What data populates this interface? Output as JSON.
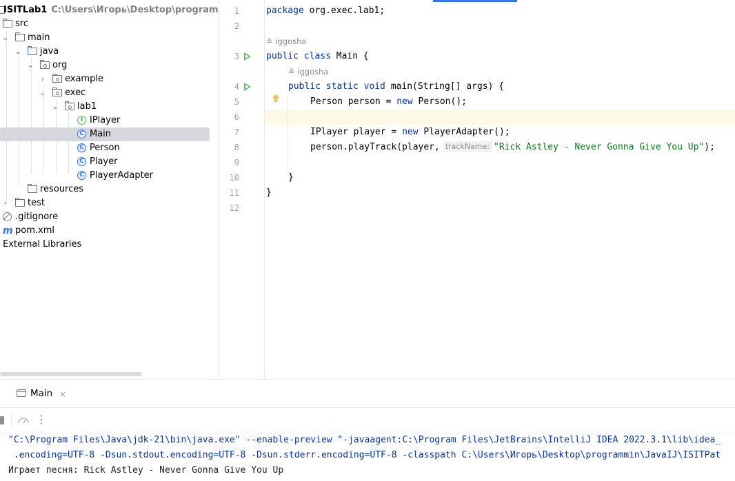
{
  "project": {
    "root_name": "ISITLab1",
    "root_path": "C:\\Users\\Игорь\\Desktop\\programmin\\Jav",
    "items": [
      {
        "label": "src"
      },
      {
        "label": "main"
      },
      {
        "label": "java"
      },
      {
        "label": "org"
      },
      {
        "label": "example"
      },
      {
        "label": "exec"
      },
      {
        "label": "lab1"
      },
      {
        "label": "IPlayer"
      },
      {
        "label": "Main"
      },
      {
        "label": "Person"
      },
      {
        "label": "Player"
      },
      {
        "label": "PlayerAdapter"
      },
      {
        "label": "resources"
      },
      {
        "label": "test"
      },
      {
        "label": ".gitignore"
      },
      {
        "label": "pom.xml"
      },
      {
        "label": "External Libraries"
      }
    ]
  },
  "editor": {
    "line_numbers": [
      "1",
      "2",
      "3",
      "4",
      "5",
      "6",
      "7",
      "8",
      "9",
      "10",
      "11",
      "12"
    ],
    "author": "iggosha",
    "code": {
      "l1_kw": "package",
      "l1_rest": " org.exec.lab1;",
      "l3_kw": "public class",
      "l3_rest": " Main {",
      "l4_kw1": "public static void",
      "l4_rest": " main(String[] args) {",
      "l5_a": "Person person = ",
      "l5_kw": "new",
      "l5_b": " Person();",
      "l7_a": "IPlayer player = ",
      "l7_kw": "new",
      "l7_b": " PlayerAdapter();",
      "l8_a": "person.playTrack(player,",
      "l8_hint": "trackName:",
      "l8_str": "\"Rick Astley - Never Gonna Give You Up\"",
      "l8_b": ");",
      "l10": "}",
      "l11": "}"
    }
  },
  "run": {
    "tab_label": "Main",
    "tab_close": "×",
    "console": [
      "\"C:\\Program Files\\Java\\jdk-21\\bin\\java.exe\" --enable-preview \"-javaagent:C:\\Program Files\\JetBrains\\IntelliJ IDEA 2022.3.1\\lib\\idea_",
      " .encoding=UTF-8 -Dsun.stdout.encoding=UTF-8 -Dsun.stderr.encoding=UTF-8 -classpath C:\\Users\\Игорь\\Desktop\\programmin\\JavaIJ\\ISITPat",
      "Играет песня: Rick Astley - Never Gonna Give You Up"
    ]
  },
  "colors": {
    "keyword": "#0033b3",
    "string": "#067d17",
    "selection": "#d5d7dc",
    "run_green": "#5fb865",
    "accent": "#3574f0"
  }
}
